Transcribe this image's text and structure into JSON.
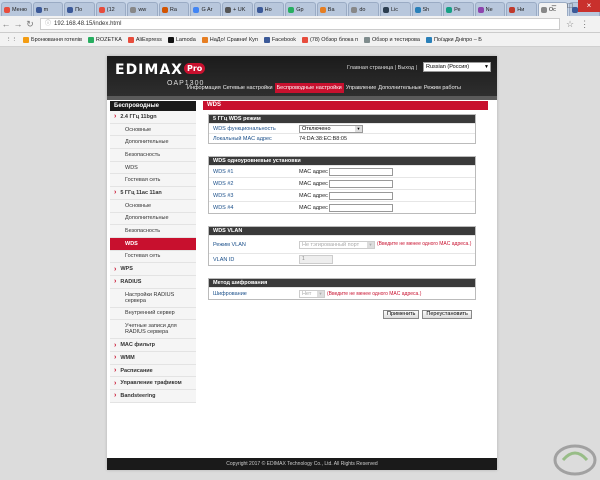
{
  "browser": {
    "tabs": [
      {
        "label": "Меню",
        "color": "#e74c3c"
      },
      {
        "label": "m",
        "color": "#3b5998"
      },
      {
        "label": "По",
        "color": "#3b5998"
      },
      {
        "label": "(12",
        "color": "#e74c3c"
      },
      {
        "label": "ww",
        "color": "#888888"
      },
      {
        "label": "Ra",
        "color": "#d35400"
      },
      {
        "label": "G Ar",
        "color": "#4285f4"
      },
      {
        "label": "+ UK",
        "color": "#555555"
      },
      {
        "label": "Но",
        "color": "#3b5998"
      },
      {
        "label": "Gp",
        "color": "#27ae60"
      },
      {
        "label": "Ва",
        "color": "#e67e22"
      },
      {
        "label": "do",
        "color": "#888888"
      },
      {
        "label": "Lic",
        "color": "#2c3e50"
      },
      {
        "label": "Sh",
        "color": "#2980b9"
      },
      {
        "label": "Ре",
        "color": "#16a085"
      },
      {
        "label": "Ne",
        "color": "#8e44ad"
      },
      {
        "label": "Ни",
        "color": "#c0392b"
      },
      {
        "label": "Ос",
        "color": "#888888"
      },
      {
        "label": "но",
        "color": "#3b5998"
      }
    ],
    "active_tab": 17,
    "url": "192.168.48.15/index.html",
    "bookmarks": [
      {
        "label": "Бронювання готелів",
        "color": "#f39c12"
      },
      {
        "label": "ROZETKA",
        "color": "#27ae60"
      },
      {
        "label": "AliExpress",
        "color": "#e74c3c"
      },
      {
        "label": "Lamoda",
        "color": "#111111"
      },
      {
        "label": "НаДо! Сравни! Куп",
        "color": "#e67e22"
      },
      {
        "label": "Facebook",
        "color": "#3b5998"
      },
      {
        "label": "(78) Обзор блока п",
        "color": "#e74c3c"
      },
      {
        "label": "Обзор и тестирова",
        "color": "#7f8c8d"
      },
      {
        "label": "Поїздки Дніпро – Б",
        "color": "#2980b9"
      }
    ]
  },
  "router": {
    "brand": "EDIMAX",
    "brand_suffix": "Pro",
    "model": "OAP1300",
    "toplinks": "Главная страница | Выход |",
    "language": "Russian (Россия)",
    "nav": [
      "Информация",
      "Сетевые настройки",
      "Беспроводные настройки",
      "Управление",
      "Дополнительные",
      "Режим работы"
    ],
    "nav_active": 2,
    "sidebar_title": "Беспроводные",
    "sidebar": [
      {
        "label": "2.4 ГГц 11bgn",
        "level": 1
      },
      {
        "label": "Основные",
        "level": 2
      },
      {
        "label": "Дополнительные",
        "level": 2
      },
      {
        "label": "Безопасность",
        "level": 2
      },
      {
        "label": "WDS",
        "level": 2
      },
      {
        "label": "Гостевая сеть",
        "level": 2
      },
      {
        "label": "5 ГГц 11ac 11an",
        "level": 1
      },
      {
        "label": "Основные",
        "level": 2
      },
      {
        "label": "Дополнительные",
        "level": 2
      },
      {
        "label": "Безопасность",
        "level": 2
      },
      {
        "label": "WDS",
        "level": 2,
        "active": true
      },
      {
        "label": "Гостевая сеть",
        "level": 2
      },
      {
        "label": "WPS",
        "level": 1
      },
      {
        "label": "RADIUS",
        "level": 1
      },
      {
        "label": "Настройки RADIUS сервера",
        "level": 2,
        "two": true
      },
      {
        "label": "Внутренний сервер",
        "level": 2
      },
      {
        "label": "Учетные записи для RADIUS сервера",
        "level": 2,
        "two": true
      },
      {
        "label": "MAC фильтр",
        "level": 1
      },
      {
        "label": "WMM",
        "level": 1
      },
      {
        "label": "Расписание",
        "level": 1
      },
      {
        "label": "Управление трафиком",
        "level": 1
      },
      {
        "label": "Bandsteering",
        "level": 1
      }
    ],
    "content_title": "WDS",
    "panel_mode": {
      "title": "5 ГГц WDS режим",
      "func_label": "WDS функциональность",
      "func_value": "Отключено",
      "mac_label": "Локальный MAC адрес",
      "mac_value": "74:DA:38:EC:B8:05"
    },
    "panel_peers": {
      "title": "WDS одноуровневые установки",
      "peers": [
        {
          "label": "WDS #1",
          "mac_label": "MAC адрес"
        },
        {
          "label": "WDS #2",
          "mac_label": "MAC адрес"
        },
        {
          "label": "WDS #3",
          "mac_label": "MAC адрес"
        },
        {
          "label": "WDS #4",
          "mac_label": "MAC адрес"
        }
      ]
    },
    "panel_vlan": {
      "title": "WDS VLAN",
      "mode_label": "Режим VLAN",
      "mode_value": "Не тэгированный порт",
      "mode_hint": "(Введите не менее одного MAC адреса.)",
      "id_label": "VLAN ID",
      "id_value": "1"
    },
    "panel_enc": {
      "title": "Метод шифрования",
      "enc_label": "Шифрование",
      "enc_value": "Нет",
      "enc_hint": "(Введите не менее одного MAC адреса.)"
    },
    "apply_label": "Применить",
    "reset_label": "Переустановить",
    "footer": "Copyright 2017 © EDIMAX Technology Co., Ltd. All Rights Reserved"
  }
}
